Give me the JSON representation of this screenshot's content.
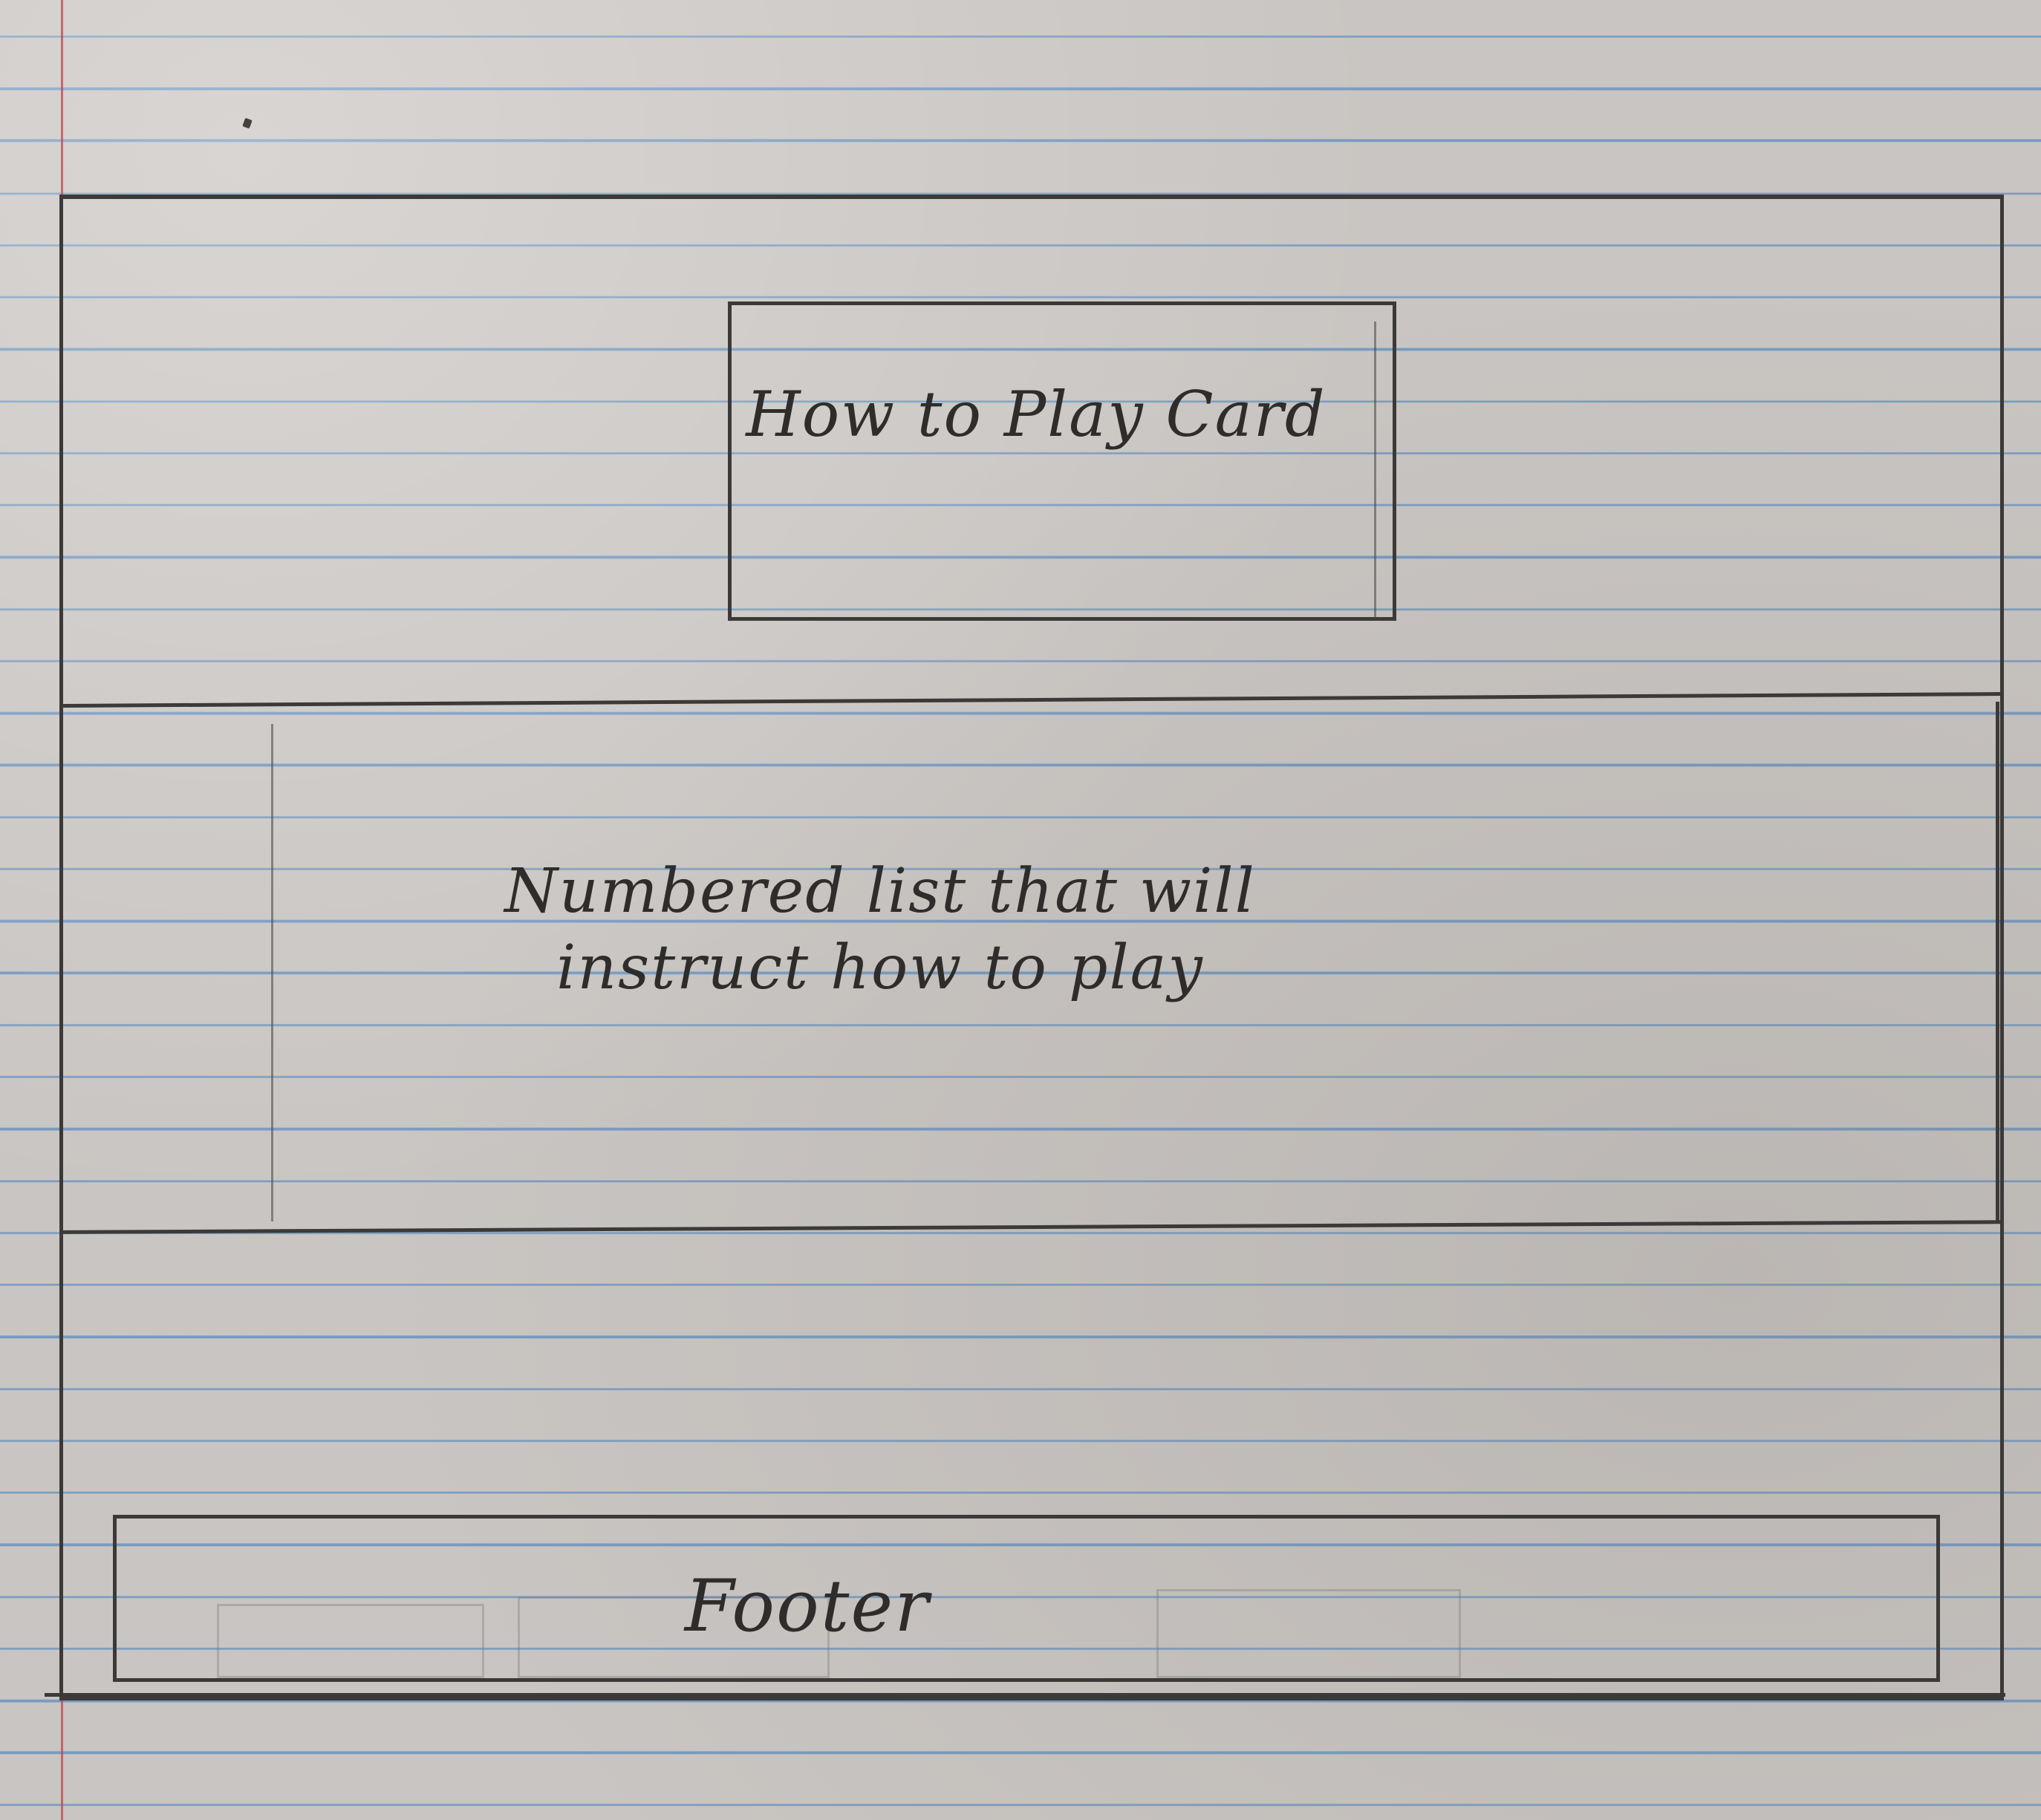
{
  "wireframe": {
    "card": {
      "text": "How to Play Card"
    },
    "instructions": {
      "text": "Numbered list that will instruct how to play"
    },
    "footer": {
      "text": "Footer"
    }
  },
  "colors": {
    "paper": "#c9c5c2",
    "rule_line": "#5c8cbe",
    "margin_line": "#be4650",
    "pencil": "#3b3a38"
  }
}
